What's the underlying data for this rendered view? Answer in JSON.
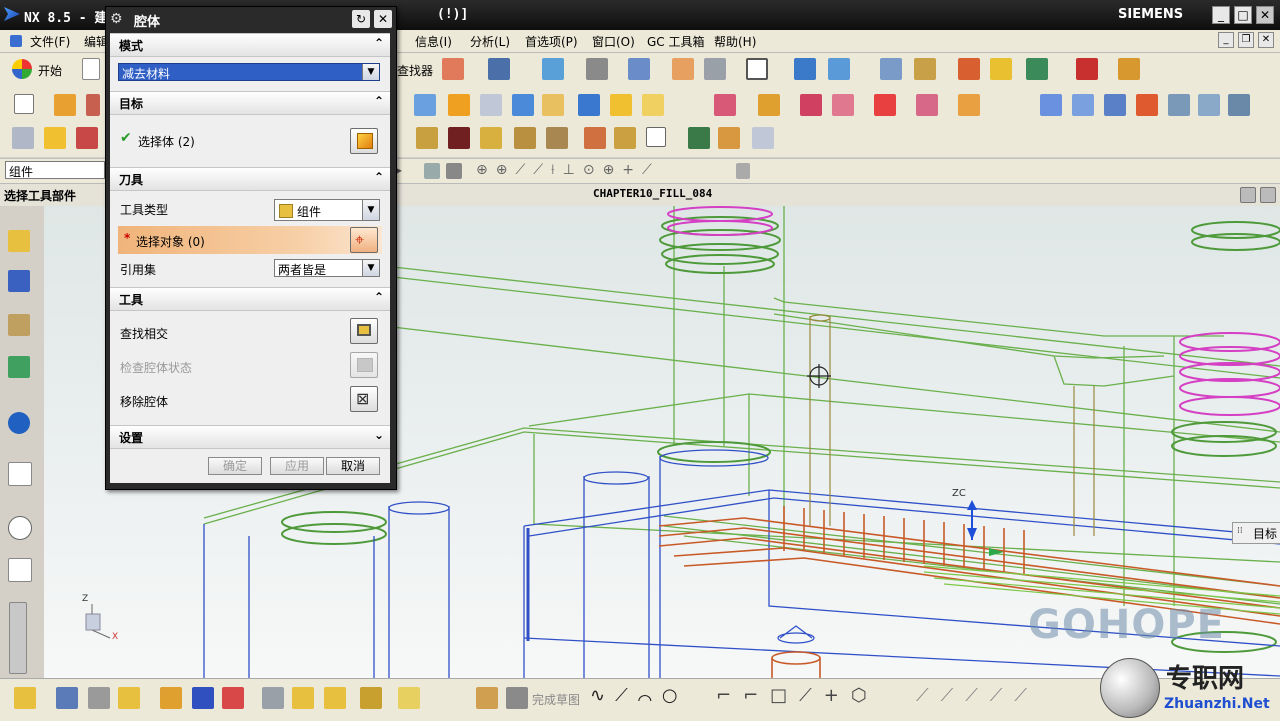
{
  "app": {
    "title_left": "NX 8.5 - 建",
    "title_mid": "(!)]",
    "brand": "SIEMENS"
  },
  "menubar": {
    "items_left": [
      "文件(F)",
      "编辑"
    ],
    "items_right": [
      "信息(I)",
      "分析(L)",
      "首选项(P)",
      "窗口(O)",
      "GC 工具箱",
      "帮助(H)"
    ]
  },
  "toolbar": {
    "start_label": "开始",
    "find_label": "查找器",
    "filter_value": "组件",
    "select_part_label": "选择工具部件",
    "view_title": "CHAPTER10_FILL_084"
  },
  "dialog": {
    "title": "腔体",
    "sections": {
      "mode": "模式",
      "target": "目标",
      "tool": "刀具",
      "tools": "工具",
      "settings": "设置"
    },
    "mode_value": "减去材料",
    "select_body": "选择体 (2)",
    "tool_type_label": "工具类型",
    "tool_type_value": "组件",
    "select_object": "选择对象 (0)",
    "ref_set_label": "引用集",
    "ref_set_value": "两者皆是",
    "find_intersect": "查找相交",
    "check_status": "检查腔体状态",
    "remove_cavity": "移除腔体",
    "ok": "确定",
    "apply": "应用",
    "cancel": "取消"
  },
  "viewport": {
    "axis_label": "ZC",
    "side_tab": "目标",
    "watermark": "GOHOPE",
    "triad_z": "Z",
    "triad_x": "X"
  },
  "bottom": {
    "finish_sketch": "完成草图"
  },
  "footer_logo": {
    "text": "专职网",
    "url": "Zhuanzhi.Net"
  }
}
